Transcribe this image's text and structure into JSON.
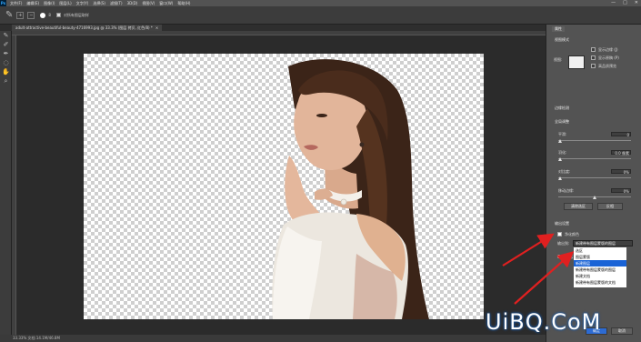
{
  "app": {
    "logo": "Ps",
    "menus": [
      "文件(F)",
      "编辑(E)",
      "图像(I)",
      "图层(L)",
      "文字(Y)",
      "选择(S)",
      "滤镜(T)",
      "3D(D)",
      "视图(V)",
      "窗口(W)",
      "帮助(H)"
    ],
    "window_controls": [
      "—",
      "□",
      "✕"
    ]
  },
  "options_bar": {
    "tool_icon": "quick-select-brush-icon",
    "mode_new": "+",
    "mode_sub": "−",
    "brush_size": "8",
    "sample_all_label": "对所有图层取样"
  },
  "document_tab": {
    "title": "adult-attractive-beautiful-beauty-4716993.jpg @ 33.3% (图层 拷贝, 红色/8) *",
    "close": "×"
  },
  "status_bar": {
    "text": "33.33%    文档:14.1M/46.8M"
  },
  "properties_panel": {
    "tab": "属性",
    "view_mode": {
      "title": "视图模式",
      "view_label": "视图:",
      "show_edge": "显示边缘 (J)",
      "show_original": "显示原稿 (P)",
      "hq_preview": "高品质预览"
    },
    "edge_detection": {
      "title": "边缘检测"
    },
    "global_refine": {
      "title": "全局调整",
      "smooth_label": "平滑:",
      "smooth_value": "0",
      "feather_label": "羽化:",
      "feather_value": "0.0 像素",
      "contrast_label": "对比度:",
      "contrast_value": "0%",
      "shift_edge_label": "移动边缘:",
      "shift_edge_value": "0%",
      "clear_selection": "清除选区",
      "invert": "反相"
    },
    "output": {
      "title": "输出设置",
      "decontaminate_label": "净化颜色",
      "output_to_label": "输出到:",
      "output_to_value": "新建带有图层蒙版的图层",
      "remember_label": "记住设置",
      "options": [
        "选区",
        "图层蒙版",
        "新建图层",
        "新建带有图层蒙版的图层",
        "新建文档",
        "新建带有图层蒙版的文档"
      ],
      "selected_option_index": 2
    },
    "ok": "确定",
    "cancel": "取消"
  },
  "watermark": {
    "text": "UiBQ.CoM"
  },
  "accent_colors": {
    "selection_blue": "#1a63d6",
    "arrow_red": "#e02020",
    "panel_bg": "#535353"
  }
}
